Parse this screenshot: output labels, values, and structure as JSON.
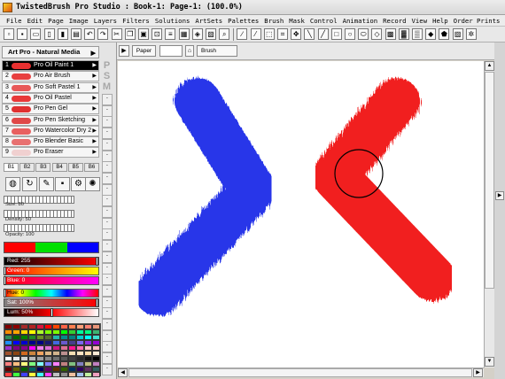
{
  "window": {
    "title": "TwistedBrush Pro Studio : Book-1: Page-1:   (100.0%)"
  },
  "menu": [
    "File",
    "Edit",
    "Page",
    "Image",
    "Layers",
    "Filters",
    "Solutions",
    "ArtSets",
    "Palettes",
    "Brush",
    "Mask",
    "Control",
    "Animation",
    "Record",
    "View",
    "Help",
    "Order Prints"
  ],
  "brush_set": {
    "title": "Art Pro - Natural Media",
    "arrow": "▶"
  },
  "brushes": [
    {
      "num": "1",
      "name": "Pro Oil Paint 1",
      "color": "#e83030",
      "selected": true
    },
    {
      "num": "2",
      "name": "Pro Air Brush",
      "color": "#e84040"
    },
    {
      "num": "3",
      "name": "Pro Soft Pastel 1",
      "color": "#e85858"
    },
    {
      "num": "4",
      "name": "Pro Oil Pastel",
      "color": "#e83838"
    },
    {
      "num": "5",
      "name": "Pro Pen Gel",
      "color": "#e03030"
    },
    {
      "num": "6",
      "name": "Pro Pen Sketching",
      "color": "#e04848"
    },
    {
      "num": "7",
      "name": "Pro Watercolor Dry 2",
      "color": "#e86060"
    },
    {
      "num": "8",
      "name": "Pro Blender Basic",
      "color": "#e87070"
    },
    {
      "num": "9",
      "name": "Pro Eraser",
      "color": "#f0d0d0"
    }
  ],
  "psm": [
    "P",
    "S",
    "M"
  ],
  "brush_tabs": [
    "B1",
    "B2",
    "B3",
    "B4",
    "B5",
    "B6"
  ],
  "sliders": {
    "size": "Size: 80",
    "density": "Density: 50",
    "opacity": "Opacity: 100"
  },
  "color": {
    "red": "Red: 255",
    "green": "Green: 0",
    "blue": "Blue: 0",
    "hue": "Hue: 0",
    "sat": "Sat: 100%",
    "lum": "Lum: 50%",
    "current": "#ff0000",
    "secondary": "#00e000",
    "third": "#0000ff"
  },
  "paper": {
    "label": "Paper",
    "brush_label": "Brush"
  },
  "strokes": {
    "left_color": "#1428e8",
    "right_color": "#f01010"
  }
}
